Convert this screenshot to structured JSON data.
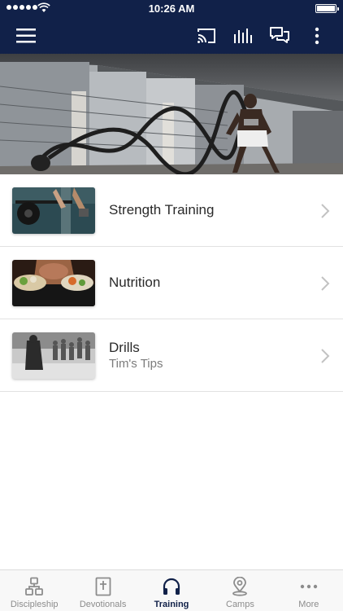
{
  "status_bar": {
    "time": "10:26 AM"
  },
  "nav": {
    "icons": [
      "menu-icon",
      "cast-icon",
      "equalizer-icon",
      "chat-icon",
      "more-vertical-icon"
    ]
  },
  "hero": {
    "image": "man doing battle rope workout under a bridge"
  },
  "list": [
    {
      "title": "Strength Training",
      "subtitle": ""
    },
    {
      "title": "Nutrition",
      "subtitle": ""
    },
    {
      "title": "Drills",
      "subtitle": "Tim's Tips"
    }
  ],
  "tabs": [
    {
      "label": "Discipleship",
      "icon": "discipleship-icon",
      "active": false
    },
    {
      "label": "Devotionals",
      "icon": "bible-icon",
      "active": false
    },
    {
      "label": "Training",
      "icon": "headphones-icon",
      "active": true
    },
    {
      "label": "Camps",
      "icon": "map-pin-icon",
      "active": false
    },
    {
      "label": "More",
      "icon": "more-horizontal-icon",
      "active": false
    }
  ],
  "colors": {
    "primary": "#112149",
    "tab_inactive": "#8c8c8c"
  }
}
